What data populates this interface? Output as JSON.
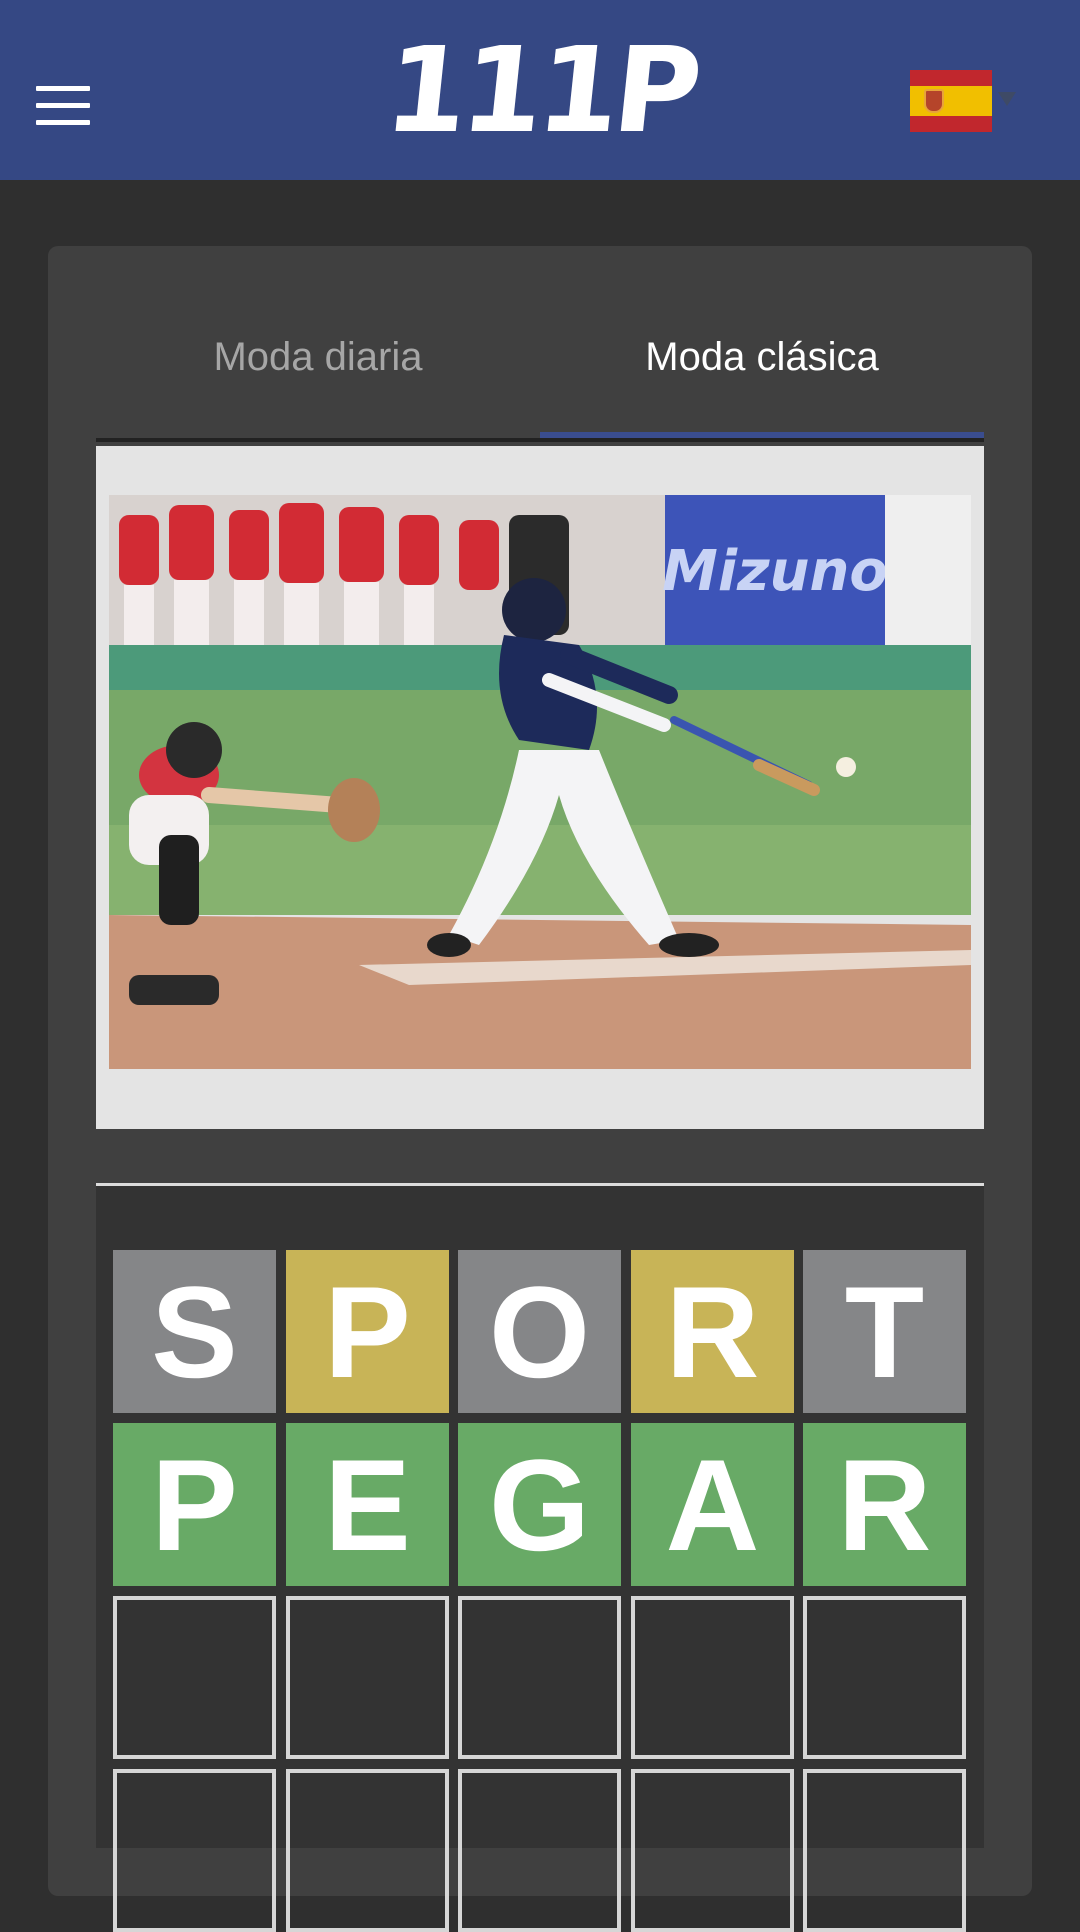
{
  "header": {
    "logo_text": "111P",
    "menu_icon": "hamburger-menu-icon",
    "language_flag": "spain-flag-icon",
    "brand_color": "#354884"
  },
  "tabs": [
    {
      "label": "Moda diaria",
      "active": false
    },
    {
      "label": "Moda clásica",
      "active": true
    }
  ],
  "image": {
    "subject": "baseball-batter-photo"
  },
  "board": {
    "colors": {
      "absent": "#858688",
      "present": "#c8b457",
      "correct": "#68aa66"
    },
    "rows": [
      [
        {
          "letter": "S",
          "state": "absent"
        },
        {
          "letter": "P",
          "state": "present"
        },
        {
          "letter": "O",
          "state": "absent"
        },
        {
          "letter": "R",
          "state": "present"
        },
        {
          "letter": "T",
          "state": "absent"
        }
      ],
      [
        {
          "letter": "P",
          "state": "correct"
        },
        {
          "letter": "E",
          "state": "correct"
        },
        {
          "letter": "G",
          "state": "correct"
        },
        {
          "letter": "A",
          "state": "correct"
        },
        {
          "letter": "R",
          "state": "correct"
        }
      ],
      [
        {
          "letter": "",
          "state": "empty"
        },
        {
          "letter": "",
          "state": "empty"
        },
        {
          "letter": "",
          "state": "empty"
        },
        {
          "letter": "",
          "state": "empty"
        },
        {
          "letter": "",
          "state": "empty"
        }
      ],
      [
        {
          "letter": "",
          "state": "empty"
        },
        {
          "letter": "",
          "state": "empty"
        },
        {
          "letter": "",
          "state": "empty"
        },
        {
          "letter": "",
          "state": "empty"
        },
        {
          "letter": "",
          "state": "empty"
        }
      ]
    ]
  }
}
